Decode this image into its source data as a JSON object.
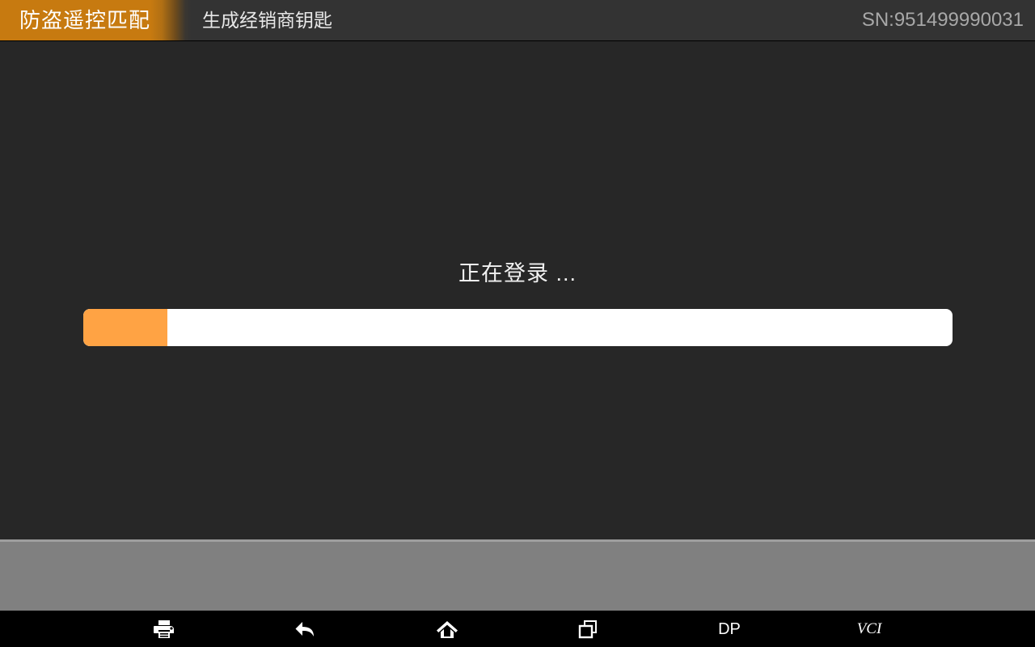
{
  "header": {
    "tab_label": "防盗遥控匹配",
    "subtitle": "生成经销商钥匙",
    "serial": "SN:951499990031",
    "tab_color": "#c77a10",
    "bar_color": "#333333"
  },
  "content": {
    "status_text": "正在登录 ...",
    "progress": {
      "percent": 9.7,
      "fill_color": "#ffa344",
      "track_color": "#ffffff"
    },
    "background_color": "#272727"
  },
  "gray_panel": {
    "color": "#808080",
    "border_color": "#9e9e9e"
  },
  "navbar": {
    "background_color": "#000000",
    "items": [
      {
        "name": "print-icon",
        "icon": "printer",
        "label": ""
      },
      {
        "name": "back-icon",
        "icon": "back-arrow",
        "label": ""
      },
      {
        "name": "home-icon",
        "icon": "home",
        "label": ""
      },
      {
        "name": "recents-icon",
        "icon": "recent-apps",
        "label": ""
      },
      {
        "name": "dp-button",
        "icon": "text",
        "label": "DP"
      },
      {
        "name": "vci-button",
        "icon": "text",
        "label": "VCI"
      }
    ]
  }
}
